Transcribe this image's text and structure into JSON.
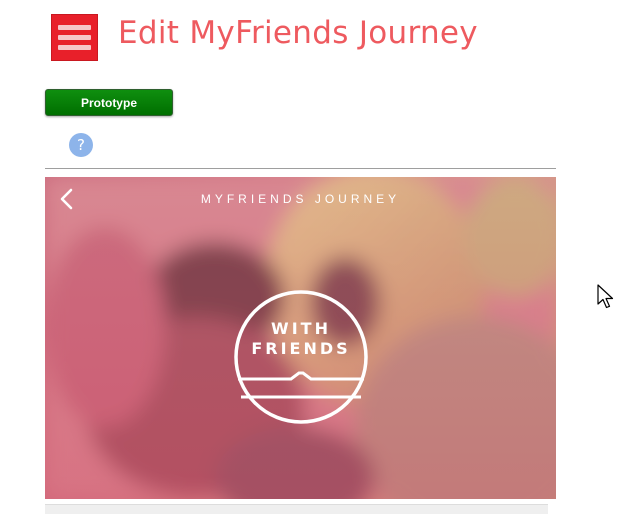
{
  "header": {
    "title": "Edit MyFriends Journey",
    "menu_icon": "hamburger-icon",
    "accent_color": "#e8202a"
  },
  "badge": {
    "label": "Prototype",
    "color": "#0a800a"
  },
  "help": {
    "icon": "help-icon",
    "glyph": "?"
  },
  "screen": {
    "title": "MYFRIENDS JOURNEY",
    "back_icon": "chevron-left-icon",
    "logo": {
      "line1": "WITH",
      "line2": "FRIENDS"
    }
  }
}
